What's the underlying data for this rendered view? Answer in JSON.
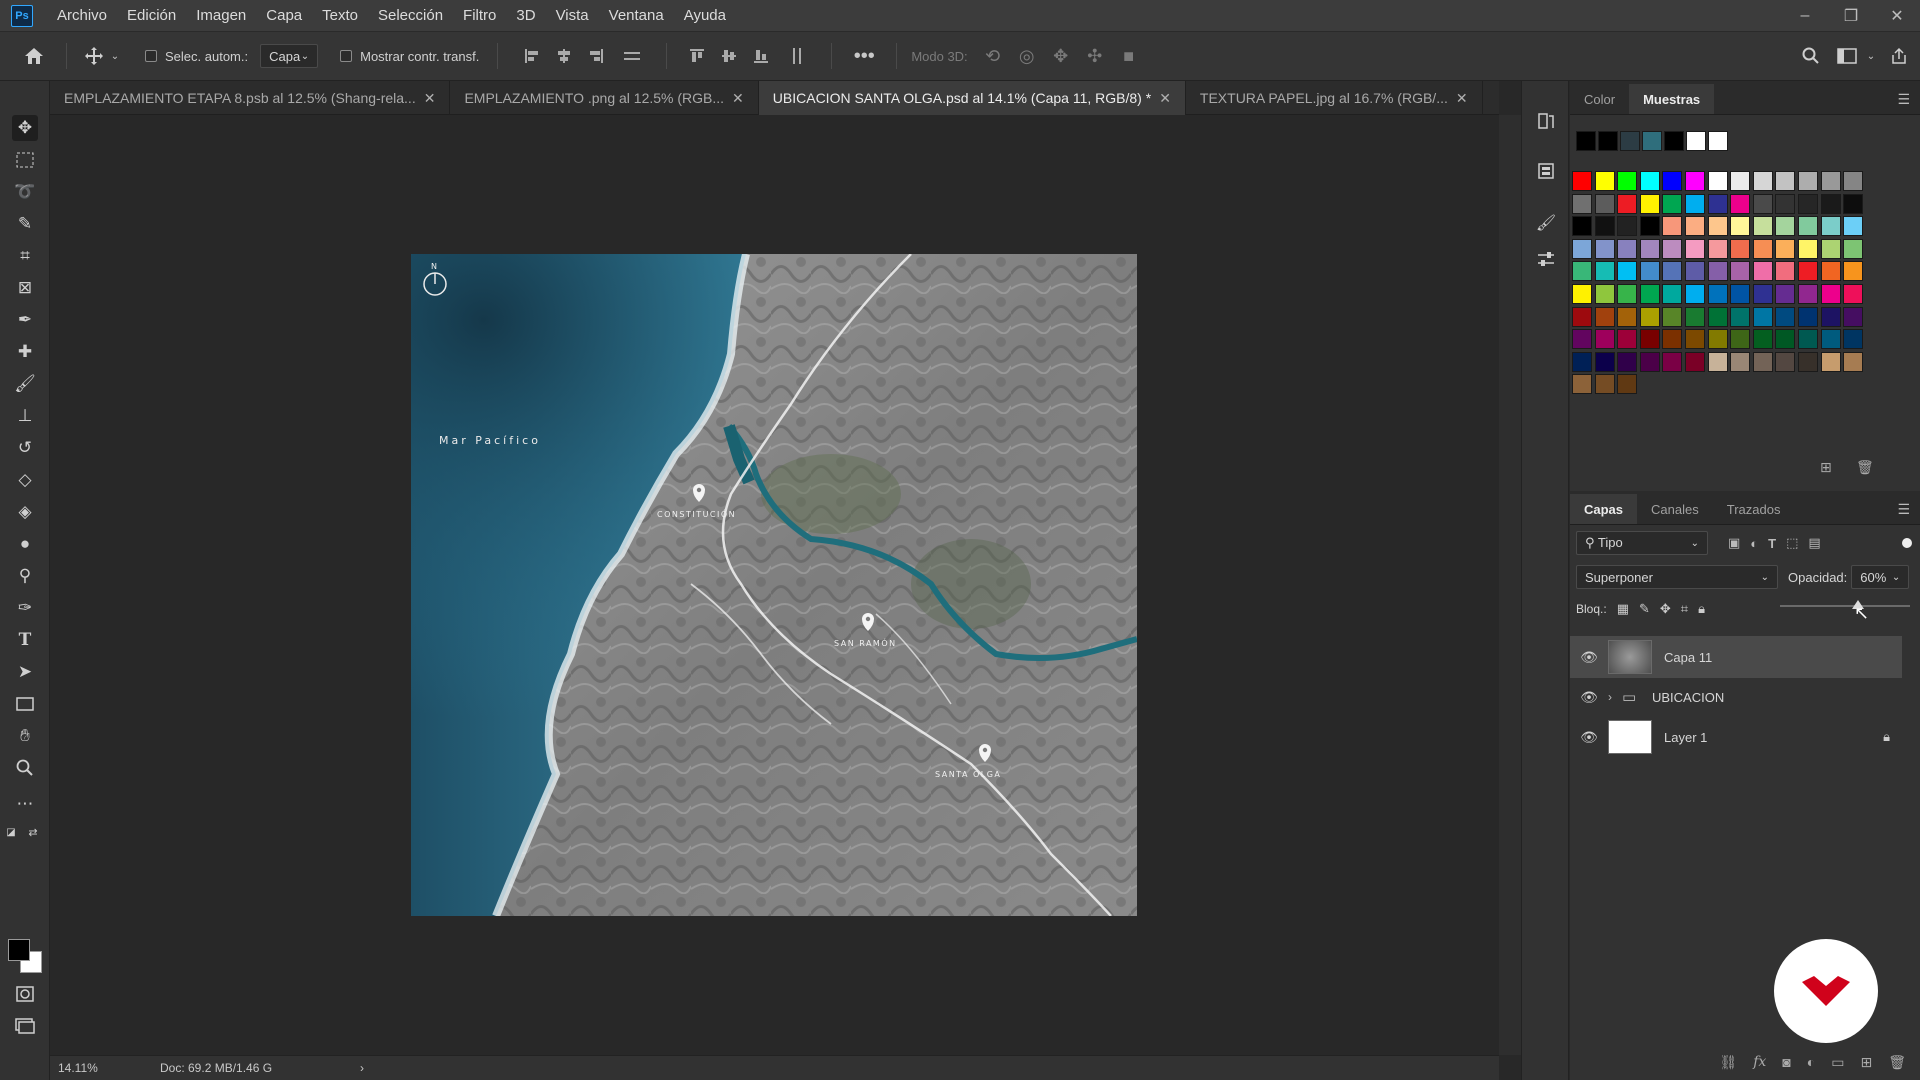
{
  "app": {
    "logo": "Ps"
  },
  "menu": [
    "Archivo",
    "Edición",
    "Imagen",
    "Capa",
    "Texto",
    "Selección",
    "Filtro",
    "3D",
    "Vista",
    "Ventana",
    "Ayuda"
  ],
  "window_controls": {
    "minimize": "–",
    "restore": "❐",
    "close": "✕"
  },
  "options": {
    "auto_select_label": "Selec. autom.:",
    "auto_select_value": "Capa",
    "show_transform_label": "Mostrar contr. transf.",
    "mode3d_label": "Modo 3D:"
  },
  "tabs": [
    {
      "label": "EMPLAZAMIENTO ETAPA 8.psb al 12.5% (Shang-rela...",
      "active": false
    },
    {
      "label": "EMPLAZAMIENTO .png al 12.5% (RGB...",
      "active": false
    },
    {
      "label": "UBICACION SANTA OLGA.psd al 14.1% (Capa 11, RGB/8) *",
      "active": true
    },
    {
      "label": "TEXTURA PAPEL.jpg al 16.7% (RGB/...",
      "active": false
    }
  ],
  "canvas": {
    "north": "N",
    "ocean_label": "Mar Pacífico",
    "places": [
      "CONSTITUCIÓN",
      "SAN RAMÓN",
      "SANTA OLGA"
    ]
  },
  "status": {
    "zoom": "14.11%",
    "doc": "Doc: 69.2 MB/1.46 G",
    "arrow": "›"
  },
  "color_panel": {
    "tabs": [
      "Color",
      "Muestras"
    ],
    "active_tab": "Muestras"
  },
  "swatches": {
    "recent": [
      "#000000",
      "#000000",
      "#2c3c44",
      "#2f6e7c",
      "#000000",
      "#ffffff",
      "#ffffff"
    ],
    "rows": [
      [
        "#ff0000",
        "#ffff00",
        "#00ff00",
        "#00ffff",
        "#0000ff",
        "#ff00ff",
        "#ffffff",
        "#ebebeb",
        "#d6d6d6",
        "#c2c2c2",
        "#adadad",
        "#999999",
        "#858585"
      ],
      [
        "#707070",
        "#5c5c5c",
        "#ed1c24",
        "#fff200",
        "#00a651",
        "#00aeef",
        "#2e3192",
        "#ec008c",
        "#4a4a4a",
        "#333333",
        "#262626",
        "#1a1a1a",
        "#0d0d0d"
      ],
      [
        "#000000",
        "#111111",
        "#222222",
        "#000000",
        "#f7977a",
        "#fbad82",
        "#fdc68c",
        "#fff799",
        "#c6df9c",
        "#a4d49d",
        "#81ca9d",
        "#7bcdc9",
        "#6ccff7"
      ],
      [
        "#7ca6d8",
        "#8293ca",
        "#8881be",
        "#a286bd",
        "#bc8cbf",
        "#f49bc1",
        "#f5999d",
        "#f16c4d",
        "#f68e54",
        "#fbaf5a",
        "#fff467",
        "#acd372",
        "#7dc473"
      ],
      [
        "#39b778",
        "#16bcb4",
        "#00bff3",
        "#438ccb",
        "#5573b7",
        "#5e5ca7",
        "#855fa8",
        "#a763a9",
        "#ef6ea8",
        "#f16d7e",
        "#ee1d24",
        "#f16522",
        "#f7941d"
      ],
      [
        "#fff100",
        "#8fc63d",
        "#37b44a",
        "#00a650",
        "#00a99e",
        "#00aeef",
        "#0072bc",
        "#0054a5",
        "#2f3192",
        "#652c91",
        "#91278f",
        "#ed008c",
        "#ee105a"
      ],
      [
        "#9d0a0e",
        "#a1410d",
        "#a36209",
        "#aba000",
        "#588528",
        "#197b30",
        "#007236",
        "#00736a",
        "#0076a4",
        "#004a80",
        "#003370",
        "#1d1363",
        "#450e61"
      ],
      [
        "#62055f",
        "#9e005c",
        "#9d0039",
        "#790000",
        "#7b3000",
        "#7c4900",
        "#827a00",
        "#3e6617",
        "#045f20",
        "#005824",
        "#005951",
        "#005b7e",
        "#003562"
      ],
      [
        "#002056",
        "#0c004b",
        "#30004a",
        "#4b0048",
        "#7a0045",
        "#7a0026",
        "#c7b299",
        "#998675",
        "#736357",
        "#534741",
        "#37302a",
        "#c69c6d",
        "#a67c52"
      ],
      [
        "#8c6239",
        "#754c24",
        "#603913"
      ]
    ]
  },
  "layers_panel": {
    "tabs": [
      "Capas",
      "Canales",
      "Trazados"
    ],
    "active_tab": "Capas",
    "filter_label": "Tipo",
    "blend_mode": "Superponer",
    "opacity_label": "Opacidad:",
    "opacity_value": "60%",
    "opacity_fraction": 0.6,
    "lock_label": "Bloq.:",
    "layers": [
      {
        "name": "Capa 11",
        "selected": true,
        "type": "image",
        "locked": false
      },
      {
        "name": "UBICACION",
        "selected": false,
        "type": "group",
        "locked": false
      },
      {
        "name": "Layer 1",
        "selected": false,
        "type": "fill",
        "locked": true
      }
    ]
  },
  "colors": {
    "accent": "#31a8ff",
    "background": "#282828",
    "panel": "#323232",
    "badge": "#d0021b"
  }
}
